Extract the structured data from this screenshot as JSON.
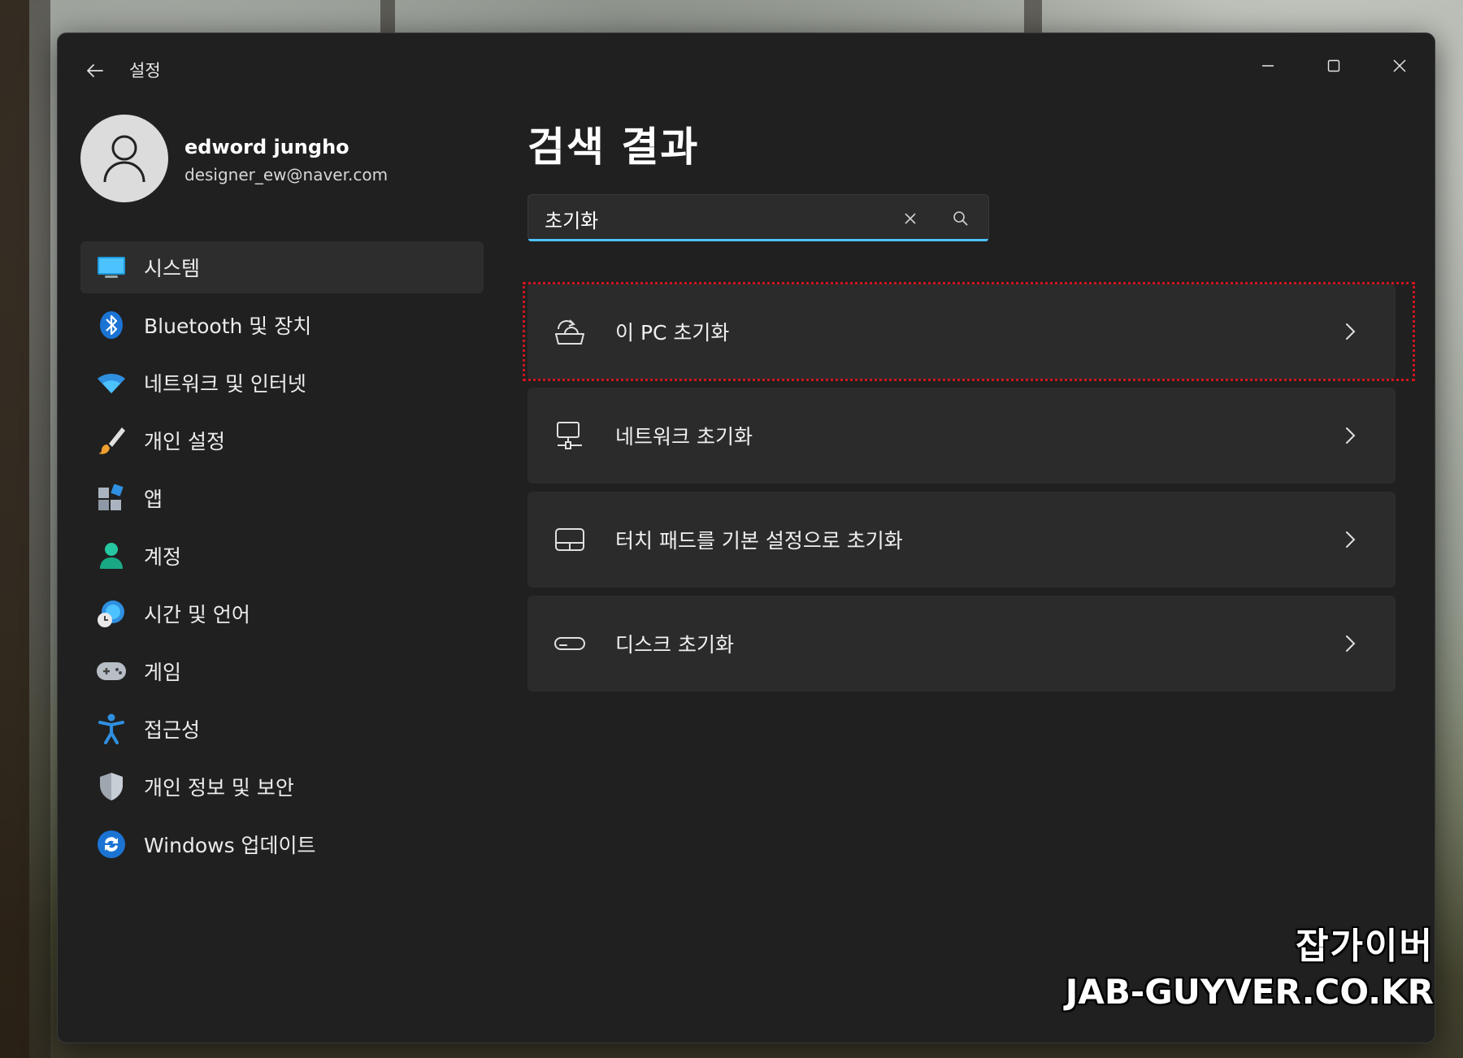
{
  "window": {
    "app_title": "설정",
    "controls": {
      "minimize": "minimize-icon",
      "maximize": "maximize-icon",
      "close": "close-icon"
    }
  },
  "profile": {
    "name": "edword jungho",
    "email": "designer_ew@naver.com"
  },
  "sidebar": {
    "items": [
      {
        "label": "시스템",
        "icon": "monitor-icon",
        "active": true
      },
      {
        "label": "Bluetooth 및 장치",
        "icon": "bluetooth-icon"
      },
      {
        "label": "네트워크 및 인터넷",
        "icon": "wifi-icon"
      },
      {
        "label": "개인 설정",
        "icon": "paintbrush-icon"
      },
      {
        "label": "앱",
        "icon": "apps-icon"
      },
      {
        "label": "계정",
        "icon": "account-icon"
      },
      {
        "label": "시간 및 언어",
        "icon": "time-language-icon"
      },
      {
        "label": "게임",
        "icon": "gamepad-icon"
      },
      {
        "label": "접근성",
        "icon": "accessibility-icon"
      },
      {
        "label": "개인 정보 및 보안",
        "icon": "shield-icon"
      },
      {
        "label": "Windows 업데이트",
        "icon": "update-icon"
      }
    ]
  },
  "main": {
    "title": "검색 결과",
    "search": {
      "value": "초기화",
      "placeholder": ""
    },
    "results": [
      {
        "label": "이 PC 초기화",
        "icon": "reset-pc-icon",
        "highlighted": true
      },
      {
        "label": "네트워크 초기화",
        "icon": "network-reset-icon"
      },
      {
        "label": "터치 패드를 기본 설정으로 초기화",
        "icon": "touchpad-icon"
      },
      {
        "label": "디스크 초기화",
        "icon": "disk-icon"
      }
    ]
  },
  "watermark": {
    "korean": "잡가이버",
    "url": "JAB-GUYVER.CO.KR"
  },
  "colors": {
    "window_bg": "#202020",
    "card_bg": "#2b2b2b",
    "accent": "#4cc2ff",
    "highlight": "#d0141e"
  }
}
